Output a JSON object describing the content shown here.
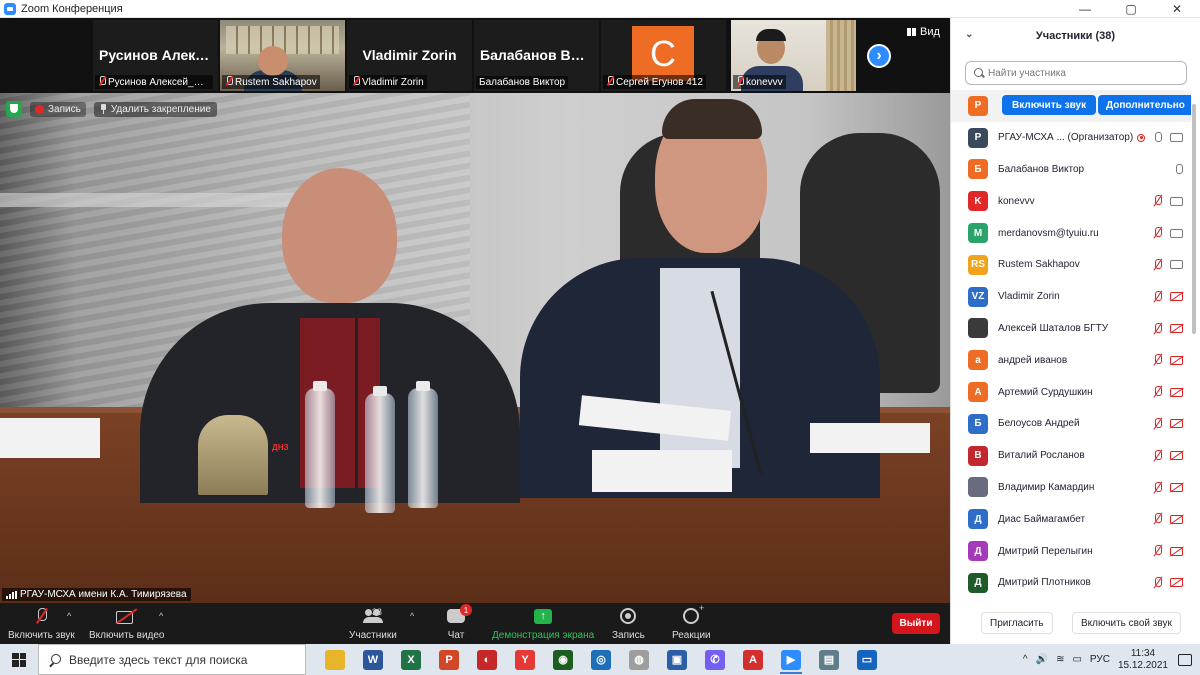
{
  "window": {
    "title": "Zoom Конференция",
    "controls": [
      "—",
      "▢",
      "✕"
    ]
  },
  "strip": {
    "tiles": [
      {
        "big_name": "Русинов Алекс...",
        "caption": "Русинов Алексей_Сар..."
      },
      {
        "caption": "Rustem Sakhapov"
      },
      {
        "big_name": "Vladimir Zorin",
        "caption": "Vladimir Zorin"
      },
      {
        "big_name": "Балабанов Вик...",
        "caption": "Балабанов Виктор"
      },
      {
        "avatar_letter": "C",
        "caption": "Сергей Егунов 412"
      },
      {
        "caption": "konevvv"
      }
    ],
    "view_label": "Вид"
  },
  "main": {
    "badges": {
      "recording_label": "Запись",
      "unpin_label": "Удалить закрепление"
    },
    "speaker": "РГАУ-МСХА имени К.А. Тимирязева",
    "label_tab": "ДНЗ"
  },
  "toolbar": {
    "audio": "Включить звук",
    "video": "Включить видео",
    "participants": "Участники",
    "participants_count": "38",
    "chat": "Чат",
    "chat_badge": "1",
    "share": "Демонстрация экрана",
    "record": "Запись",
    "reactions": "Реакции",
    "leave": "Выйти"
  },
  "panel": {
    "title": "Участники (38)",
    "search_placeholder": "Найти участника",
    "unmute_label": "Включить звук",
    "more_label": "Дополнительно",
    "first_avatar": "Р",
    "participants": [
      {
        "avatar": "Р",
        "name": "РГАУ-МСХА ...  (Организатор)",
        "color": "#3a4a5c",
        "mic": "on",
        "cam": "on",
        "rec": true
      },
      {
        "avatar": "Б",
        "name": "Балабанов Виктор",
        "color": "#ef6c25",
        "mic": "on",
        "cam": "none"
      },
      {
        "avatar": "K",
        "name": "konevvv",
        "color": "#e02828",
        "mic": "off",
        "cam": "on"
      },
      {
        "avatar": "M",
        "name": "merdanovsm@tyuiu.ru",
        "color": "#2ba36b",
        "mic": "off",
        "cam": "on"
      },
      {
        "avatar": "RS",
        "name": "Rustem Sakhapov",
        "color": "#f0a31b",
        "mic": "off",
        "cam": "on"
      },
      {
        "avatar": "VZ",
        "name": "Vladimir Zorin",
        "color": "#2f6ec7",
        "mic": "off",
        "cam": "off"
      },
      {
        "avatar": "",
        "name": "Алексей Шаталов БГТУ",
        "color": "#3a3a3a",
        "mic": "off",
        "cam": "off"
      },
      {
        "avatar": "а",
        "name": "андрей иванов",
        "color": "#ef6c25",
        "mic": "off",
        "cam": "off"
      },
      {
        "avatar": "А",
        "name": "Артемий Сурдушкин",
        "color": "#ef6c25",
        "mic": "off",
        "cam": "off"
      },
      {
        "avatar": "Б",
        "name": "Белоусов Андрей",
        "color": "#2f6ec7",
        "mic": "off",
        "cam": "off"
      },
      {
        "avatar": "В",
        "name": "Виталий Росланов",
        "color": "#c1272d",
        "mic": "off",
        "cam": "off"
      },
      {
        "avatar": "",
        "name": "Владимир Камардин",
        "color": "#6b6b80",
        "mic": "off",
        "cam": "off"
      },
      {
        "avatar": "Д",
        "name": "Диас Баймагамбет",
        "color": "#2f6ec7",
        "mic": "off",
        "cam": "off"
      },
      {
        "avatar": "Д",
        "name": "Дмитрий Перелыгин",
        "color": "#a43ab8",
        "mic": "off",
        "cam": "off"
      },
      {
        "avatar": "Д",
        "name": "Дмитрий Плотников",
        "color": "#1f5a2a",
        "mic": "off",
        "cam": "off"
      }
    ],
    "invite_label": "Пригласить",
    "unmute_me_label": "Включить свой звук"
  },
  "taskbar": {
    "search_placeholder": "Введите здесь текст для поиска",
    "apps": [
      {
        "icon": "file-explorer-icon",
        "color": "#e8b52a",
        "glyph": ""
      },
      {
        "icon": "word-icon",
        "color": "#2b579a",
        "glyph": "W"
      },
      {
        "icon": "excel-icon",
        "color": "#217346",
        "glyph": "X"
      },
      {
        "icon": "powerpoint-icon",
        "color": "#d24726",
        "glyph": "P"
      },
      {
        "icon": "app-red-icon",
        "color": "#c62828",
        "glyph": "◐"
      },
      {
        "icon": "yandex-browser-icon",
        "color": "#e53935",
        "glyph": "Y"
      },
      {
        "icon": "browser-green-icon",
        "color": "#1b5e20",
        "glyph": "◉"
      },
      {
        "icon": "settings-globe-icon",
        "color": "#1e6fb8",
        "glyph": "◎"
      },
      {
        "icon": "chrome-icon",
        "color": "#9e9e9e",
        "glyph": "◍"
      },
      {
        "icon": "floppy-icon",
        "color": "#2c5ea8",
        "glyph": "▣"
      },
      {
        "icon": "viber-icon",
        "color": "#7360f2",
        "glyph": "✆"
      },
      {
        "icon": "acrobat-icon",
        "color": "#d32f2f",
        "glyph": "A"
      },
      {
        "icon": "zoom-icon",
        "color": "#2d8cff",
        "glyph": "▶"
      },
      {
        "icon": "scanner-icon",
        "color": "#607d8b",
        "glyph": "▤"
      },
      {
        "icon": "window-icon",
        "color": "#1565c0",
        "glyph": "▭"
      }
    ],
    "tray_chevron": "^",
    "tray_sound": "🔊",
    "tray_network": "≋",
    "tray_battery": "▭",
    "language": "РУС",
    "time": "11:34",
    "date": "15.12.2021"
  }
}
